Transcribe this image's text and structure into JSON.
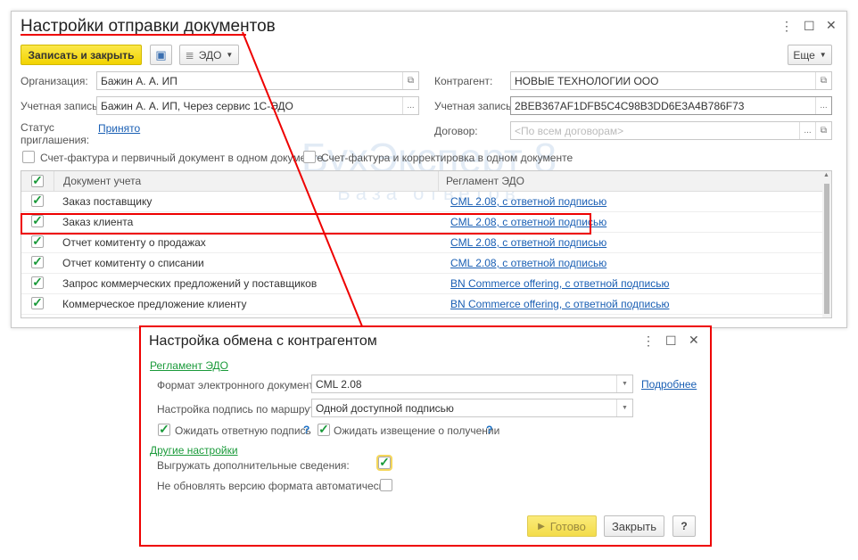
{
  "main": {
    "title": "Настройки отправки документов",
    "toolbar": {
      "save_close": "Записать и закрыть",
      "edo": "ЭДО",
      "more": "Еще"
    },
    "fields": {
      "org_label": "Организация:",
      "org_value": "Бажин А. А. ИП",
      "account_label": "Учетная запись:",
      "account_value": "Бажин А. А. ИП, Через сервис 1С-ЭДО",
      "status_label_1": "Статус",
      "status_label_2": "приглашения:",
      "status_value": "Принято",
      "counterparty_label": "Контрагент:",
      "counterparty_value": "НОВЫЕ ТЕХНОЛОГИИ ООО",
      "cp_account_label": "Учетная запись:",
      "cp_account_value": "2BEB367AF1DFB5C4C98B3DD6E3A4B786F73",
      "contract_label": "Договор:",
      "contract_placeholder": "<По всем договорам>"
    },
    "checkboxes": {
      "invoice_primary": "Счет-фактура и первичный документ в одном документе",
      "invoice_correction": "Счет-фактура и корректировка в одном документе"
    },
    "table": {
      "headers": [
        "Документ учета",
        "Регламент ЭДО"
      ],
      "rows": [
        {
          "doc": "Заказ поставщику",
          "reg": "CML 2.08, с ответной подписью"
        },
        {
          "doc": "Заказ клиента",
          "reg": "CML 2.08, с ответной подписью"
        },
        {
          "doc": "Отчет комитенту о продажах",
          "reg": "CML 2.08, с ответной подписью"
        },
        {
          "doc": "Отчет комитенту о списании",
          "reg": "CML 2.08, с ответной подписью"
        },
        {
          "doc": "Запрос коммерческих предложений у поставщиков",
          "reg": "BN Commerce offering, с ответной подписью"
        },
        {
          "doc": "Коммерческое предложение клиенту",
          "reg": "BN Commerce offering, с ответной подписью"
        }
      ]
    },
    "watermark": {
      "brand": "БухЭксперт 8",
      "tagline": "База ответов"
    }
  },
  "dialog": {
    "title": "Настройка обмена с контрагентом",
    "section1": "Регламент ЭДО",
    "format_label": "Формат электронного документа:",
    "format_value": "CML 2.08",
    "more_link": "Подробнее",
    "sign_label": "Настройка подпись по маршруту:",
    "sign_value": "Одной доступной подписью",
    "wait_sign": "Ожидать ответную подпись",
    "wait_notice": "Ожидать извещение о получении",
    "help": "?",
    "section2": "Другие настройки",
    "export_extra": "Выгружать дополнительные сведения:",
    "no_update": "Не обновлять версию формата автоматически:",
    "ok": "Готово",
    "close": "Закрыть"
  },
  "colors": {
    "highlight": "#e00000",
    "accent_yellow": "#f2d300",
    "link": "#1a5fb4",
    "green": "#1a9a3a"
  }
}
